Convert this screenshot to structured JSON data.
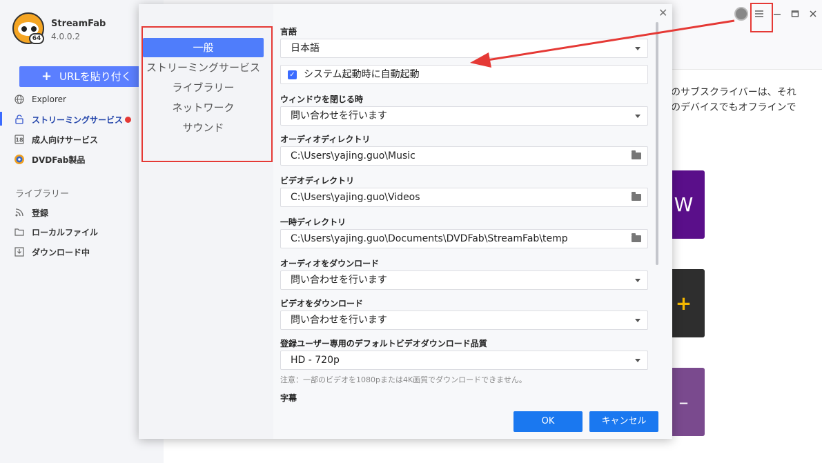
{
  "app": {
    "name": "StreamFab",
    "version": "4.0.0.2",
    "logo_badge": "64"
  },
  "sidebar": {
    "paste_url_label": "URLを貼り付く",
    "items": [
      {
        "label": "Explorer",
        "icon": "globe-icon"
      },
      {
        "label": "ストリーミングサービス",
        "icon": "lock-icon"
      },
      {
        "label": "成人向けサービス",
        "icon": "eighteen-icon"
      },
      {
        "label": "DVDFab製品",
        "icon": "dvdfab-icon"
      }
    ],
    "library_title": "ライブラリー",
    "library_items": [
      {
        "label": "登録",
        "icon": "rss-icon"
      },
      {
        "label": "ローカルファイル",
        "icon": "folder-icon"
      },
      {
        "label": "ダウンロード中",
        "icon": "download-icon"
      }
    ]
  },
  "main": {
    "text_line1": "スのサブスクライバーは、それ",
    "text_line2": "どのデバイスでもオフラインで",
    "tile1_glyph": "W",
    "tile2_glyph": "+",
    "tile3_glyph": "–"
  },
  "dialog": {
    "categories": [
      "一般",
      "ストリーミングサービス",
      "ライブラリー",
      "ネットワーク",
      "サウンド"
    ],
    "language_label": "言語",
    "language_value": "日本語",
    "autostart_label": "システム起動時に自動起動",
    "close_window_label": "ウィンドウを閉じる時",
    "close_window_value": "問い合わせを行います",
    "audio_dir_label": "オーディオディレクトリ",
    "audio_dir_value": "C:\\Users\\yajing.guo\\Music",
    "video_dir_label": "ビデオディレクトリ",
    "video_dir_value": "C:\\Users\\yajing.guo\\Videos",
    "temp_dir_label": "一時ディレクトリ",
    "temp_dir_value": "C:\\Users\\yajing.guo\\Documents\\DVDFab\\StreamFab\\temp",
    "download_audio_label": "オーディオをダウンロード",
    "download_audio_value": "問い合わせを行います",
    "download_video_label": "ビデオをダウンロード",
    "download_video_value": "問い合わせを行います",
    "quality_label": "登録ユーザー専用のデフォルトビデオダウンロード品質",
    "quality_value": "HD - 720p",
    "note": "注意：一部のビデオを1080pまたは4K画質でダウンロードできません。",
    "subtitle_label": "字幕",
    "ok_label": "OK",
    "cancel_label": "キャンセル"
  },
  "colors": {
    "accent": "#5b7fff",
    "button": "#1a78f0",
    "annotation": "#e53935"
  }
}
